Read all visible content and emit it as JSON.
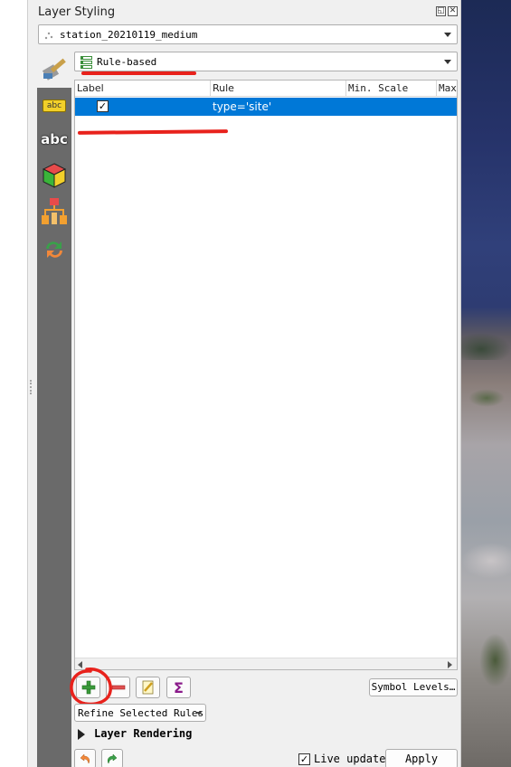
{
  "dock": {
    "title": "Layer Styling",
    "float_glyph": "◱",
    "close_glyph": "✕"
  },
  "layer_combo": {
    "value": "station_20210119_medium"
  },
  "renderer_combo": {
    "value": "Rule-based"
  },
  "side_tabs": [
    {
      "name": "symbology-paintbrush-icon"
    },
    {
      "name": "labels-abc-yellow-icon",
      "text": "abc"
    },
    {
      "name": "masks-abc-icon",
      "text": "abc"
    },
    {
      "name": "3d-view-cube-icon"
    },
    {
      "name": "diagrams-icon"
    },
    {
      "name": "history-undo-icon"
    }
  ],
  "rule_table": {
    "columns": [
      "Label",
      "Rule",
      "Min. Scale",
      "Max."
    ],
    "rows": [
      {
        "checked": true,
        "label": "",
        "rule": "type='site'"
      }
    ]
  },
  "toolbar": {
    "add_icon": "plus-icon",
    "remove_icon": "minus-icon",
    "edit_icon": "pencil-icon",
    "sigma_glyph": "Σ",
    "symbol_levels_label": "Symbol Levels…"
  },
  "refine_label": "Refine Selected Rules",
  "layer_rendering_label": "Layer Rendering",
  "footer": {
    "live_update_label": "Live update",
    "live_update_checked": true,
    "apply_label": "Apply"
  },
  "colors": {
    "selection": "#0078d7",
    "annotation_red": "#e8221c",
    "sidebar": "#6a6a6a"
  }
}
